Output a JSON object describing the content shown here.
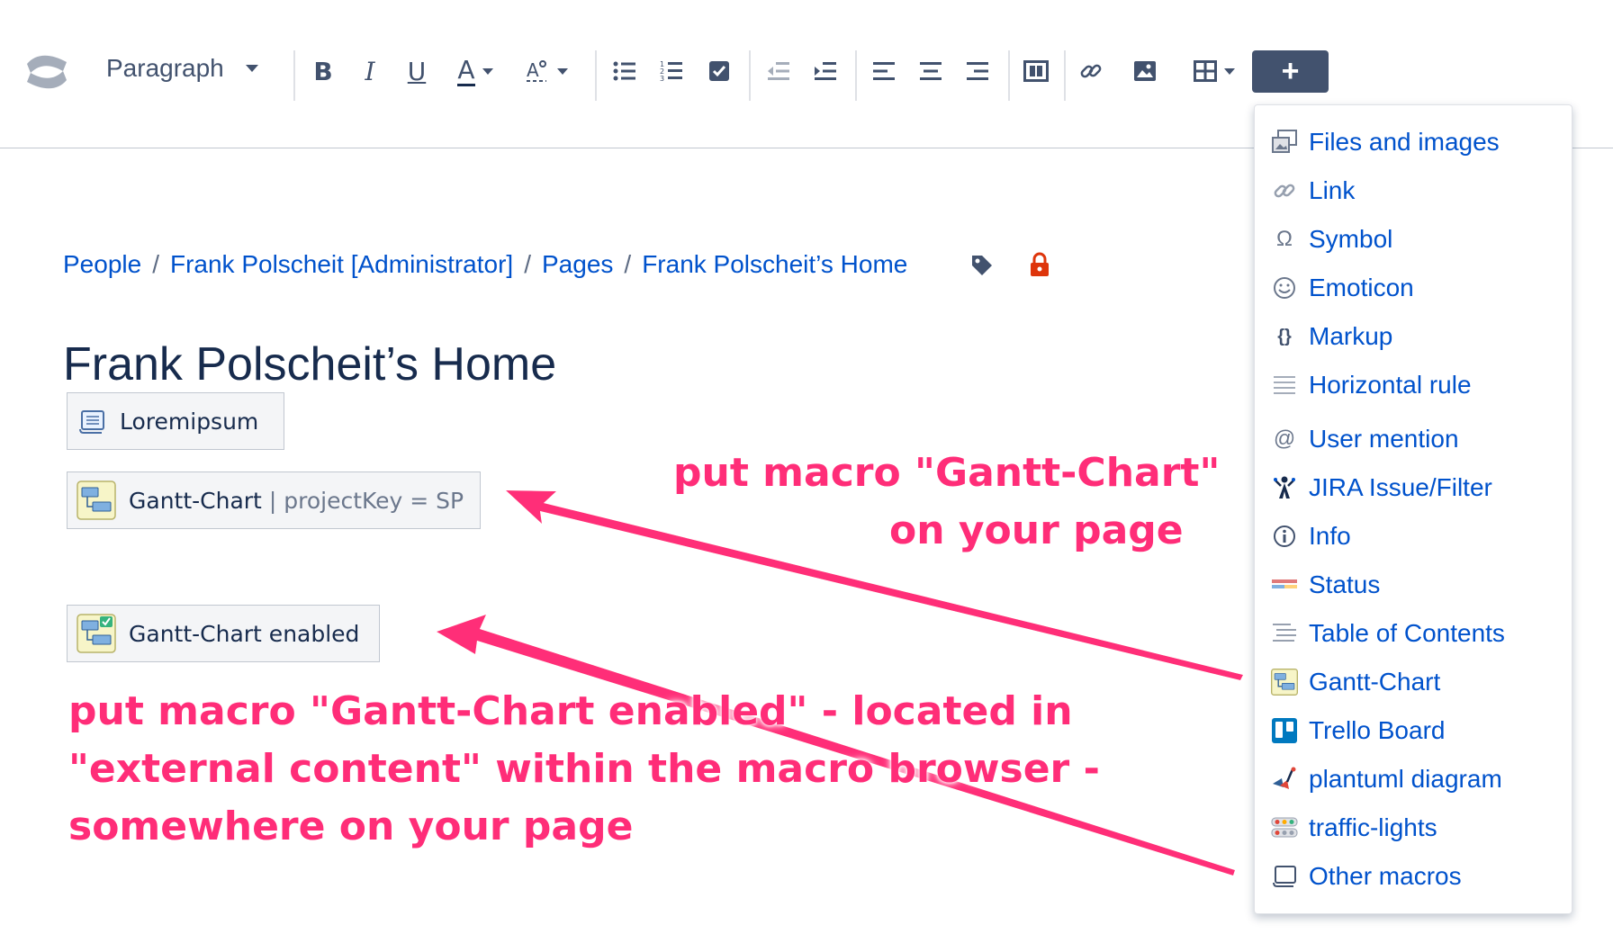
{
  "toolbar": {
    "paragraph_label": "Paragraph",
    "bold": "B",
    "italic": "I",
    "underline": "U",
    "text_color": "A",
    "insert_plus": "+"
  },
  "breadcrumb": {
    "items": [
      "People",
      "Frank Polscheit [Administrator]",
      "Pages",
      "Frank Polscheit’s Home"
    ],
    "separator": "/"
  },
  "page": {
    "title": "Frank Polscheit’s Home"
  },
  "macros": {
    "loremipsum": {
      "label": "Loremipsum"
    },
    "gantt_chart": {
      "label": "Gantt-Chart",
      "param": "| projectKey = SP"
    },
    "gantt_enabled": {
      "label": "Gantt-Chart enabled"
    }
  },
  "annotations": {
    "top_line1": "put macro \"Gantt-Chart\"",
    "top_line2": "on your page",
    "bottom_line1": "put macro \"Gantt-Chart enabled\" - located in",
    "bottom_line2": "\"external content\" within the macro browser -",
    "bottom_line3": "somewhere on your page",
    "color": "#ff2d78"
  },
  "insert_menu": {
    "items": [
      {
        "label": "Files and images",
        "icon": "files-images-icon"
      },
      {
        "label": "Link",
        "icon": "link-icon"
      },
      {
        "label": "Symbol",
        "icon": "omega-icon"
      },
      {
        "label": "Emoticon",
        "icon": "smiley-icon"
      },
      {
        "label": "Markup",
        "icon": "braces-icon"
      },
      {
        "label": "Horizontal rule",
        "icon": "lines-icon"
      },
      {
        "label": "User mention",
        "icon": "at-icon"
      },
      {
        "label": "JIRA Issue/Filter",
        "icon": "jira-icon"
      },
      {
        "label": "Info",
        "icon": "info-icon"
      },
      {
        "label": "Status",
        "icon": "status-icon"
      },
      {
        "label": "Table of Contents",
        "icon": "toc-icon"
      },
      {
        "label": "Gantt-Chart",
        "icon": "gantt-icon"
      },
      {
        "label": "Trello Board",
        "icon": "trello-icon"
      },
      {
        "label": "plantuml diagram",
        "icon": "plantuml-icon"
      },
      {
        "label": "traffic-lights",
        "icon": "traffic-lights-icon"
      },
      {
        "label": "Other macros",
        "icon": "scroll-icon"
      }
    ]
  },
  "colors": {
    "link": "#0052cc",
    "insert_button": "#42526e",
    "lock": "#de350b"
  }
}
